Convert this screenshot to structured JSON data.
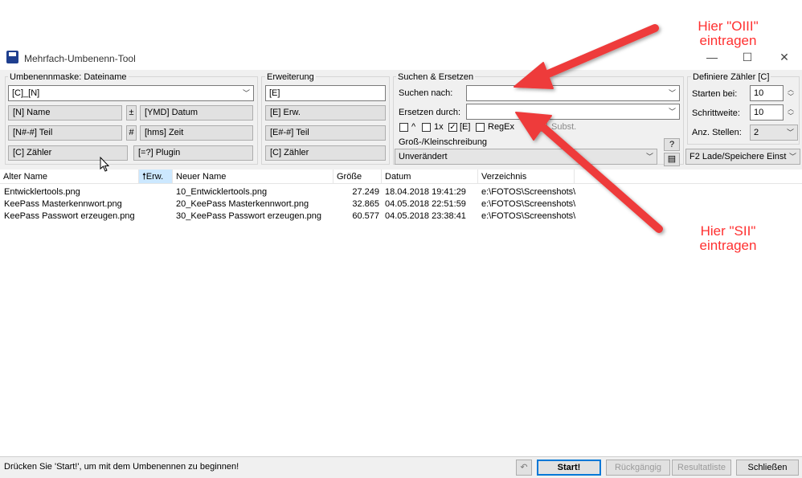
{
  "window": {
    "title": "Mehrfach-Umbenenn-Tool",
    "minimize": "—",
    "maximize": "☐",
    "close": "✕"
  },
  "mask": {
    "legend": "Umbenennmaske: Dateiname",
    "value": "[C]_[N]",
    "buttons": {
      "name": "[N]  Name",
      "plus": "±",
      "date": "[YMD]  Datum",
      "part": "[N#-#]  Teil",
      "hash": "#",
      "time": "[hms]  Zeit",
      "counter": "[C]  Zähler",
      "plugin": "[=?]  Plugin"
    }
  },
  "ext": {
    "legend": "Erweiterung",
    "value": "[E]",
    "buttons": {
      "ext": "[E]  Erw.",
      "part": "[E#-#]  Teil",
      "counter": "[C]  Zähler"
    }
  },
  "search": {
    "legend": "Suchen & Ersetzen",
    "search_label": "Suchen nach:",
    "search_value": "",
    "replace_label": "Ersetzen durch:",
    "replace_value": "",
    "opt_caret": "^",
    "opt_once": "1x",
    "opt_ext": "[E]",
    "opt_regex": "RegEx",
    "opt_subst": "Subst.",
    "case_label": "Groß-/Kleinschreibung",
    "case_value": "Unverändert",
    "help_button": "?"
  },
  "counter": {
    "legend": "Definiere Zähler [C]",
    "start_label": "Starten bei:",
    "start_value": "10",
    "step_label": "Schrittweite:",
    "step_value": "10",
    "digits_label": "Anz. Stellen:",
    "digits_value": "2",
    "load_save": "F2 Lade/Speichere Einst"
  },
  "table": {
    "columns": [
      "Alter Name",
      "Erw.",
      "Neuer Name",
      "Größe",
      "Datum",
      "Verzeichnis"
    ],
    "rows": [
      [
        "Entwicklertools.png",
        "",
        "10_Entwicklertools.png",
        "27.249",
        "18.04.2018 19:41:29",
        "e:\\FOTOS\\Screenshots\\"
      ],
      [
        "KeePass Masterkennwort.png",
        "",
        "20_KeePass Masterkennwort.png",
        "32.865",
        "04.05.2018 22:51:59",
        "e:\\FOTOS\\Screenshots\\"
      ],
      [
        "KeePass Passwort erzeugen.png",
        "",
        "30_KeePass Passwort erzeugen.png",
        "60.577",
        "04.05.2018 23:38:41",
        "e:\\FOTOS\\Screenshots\\"
      ]
    ]
  },
  "status": {
    "text": "Drücken Sie 'Start!', um mit dem Umbenennen zu beginnen!",
    "start": "Start!",
    "undo": "Rückgängig",
    "results": "Resultatliste",
    "close": "Schließen"
  },
  "annotations": {
    "top_1": "Hier \"OIII\"",
    "top_2": "eintragen",
    "bottom_1": "Hier \"SII\"",
    "bottom_2": "eintragen"
  },
  "colors": {
    "annotation": "#ff3030",
    "sort_header": "#cce8ff"
  }
}
